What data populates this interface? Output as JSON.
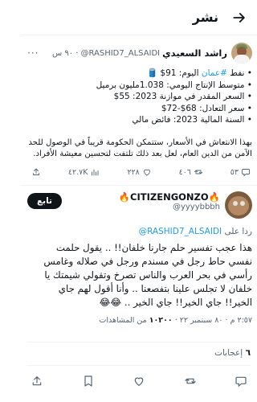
{
  "header": {
    "title": "نشر"
  },
  "quoted_tweet": {
    "author_name": "راشد السعيدي",
    "handle": "@RASHID7_ALSAIDI",
    "time": "٩٠ س",
    "lines": [
      {
        "prefix": "• نفط ",
        "hashtag": "#عمان",
        "rest": " اليوم: 91$ 🛢️"
      },
      {
        "prefix": "• متوسط الإنتاج اليومي: 1.038مليون برميل",
        "hashtag": "",
        "rest": ""
      },
      {
        "prefix": "• السعر المقدر في موازنة 2023: 55$",
        "hashtag": "",
        "rest": ""
      },
      {
        "prefix": "• سعر التعادل: 68$-72$",
        "hashtag": "",
        "rest": ""
      },
      {
        "prefix": "• السنة المالية 2023: فائض مالي",
        "hashtag": "",
        "rest": ""
      }
    ],
    "paragraph": "بهذا الانتعاش في الأسعار، ستتمكن الحكومة قريباً في الوصول للحد الآمن من الدين العام، لعل بعد ذلك تلتفت لتحسين معيشة الأفراد.",
    "actions": {
      "replies": "٥٣",
      "retweets": "٤٠٦",
      "likes": "٢٢٨",
      "views": "٤٢.٧K"
    }
  },
  "reply_tweet": {
    "author_name": "🔥CITIZENGONZO🔥",
    "handle": "@yyyybbbh",
    "follow_label": "تابع",
    "replying_prefix": "ردا على ",
    "replying_to": "@RASHID7_ALSAIDI",
    "text": "هذا عجب تفسير حلم جارنا خلفان!! .. يقول حلمت نفسي حاط رجل في مسندم ورجل في صلاله وغامس رأسي في بحر العرب والناس تصرخ وتقولي شيمتك يا خلفان لا تجلس علينا بتفصعنا .. وأنا أقول لهم جاي الخير!! جاي الخير!! جاي الخير .. 😂😂",
    "meta_time": "٢:٥٧ م · ٨٠ سبتمبر ٢٢",
    "meta_views": "١٠٢٠٠",
    "meta_views_label": "من المشاهدات"
  },
  "stats": {
    "likes_count": "٦",
    "likes_label": "إعجابات"
  }
}
